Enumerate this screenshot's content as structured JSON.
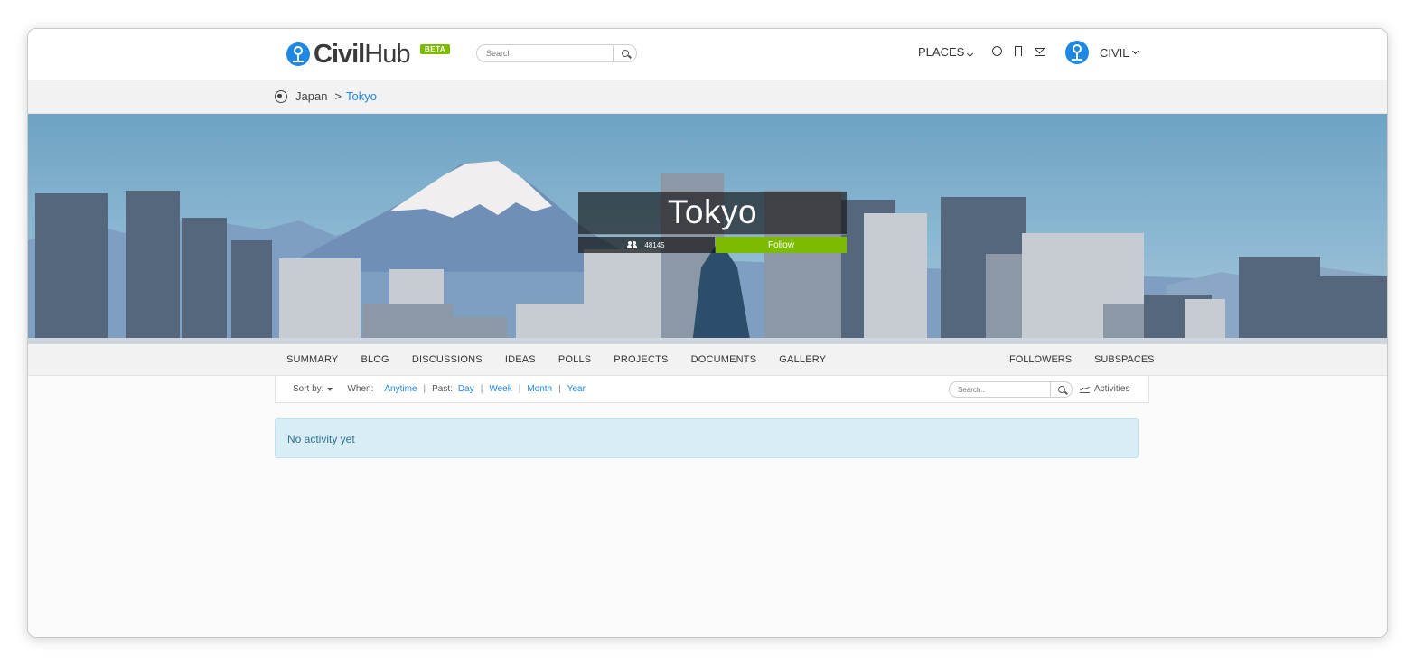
{
  "header": {
    "logo_main": "Civil",
    "logo_sub": "Hub",
    "beta_badge": "BETA",
    "search_placeholder": "Search",
    "places_label": "PLACES",
    "user_label": "CIVIL"
  },
  "breadcrumb": {
    "parent": "Japan",
    "separator": ">",
    "current": "Tokyo"
  },
  "banner": {
    "title": "Tokyo",
    "followers_count": "48145",
    "follow_label": "Follow"
  },
  "tabs": {
    "left": [
      "SUMMARY",
      "BLOG",
      "DISCUSSIONS",
      "IDEAS",
      "POLLS",
      "PROJECTS",
      "DOCUMENTS",
      "GALLERY"
    ],
    "right": [
      "FOLLOWERS",
      "SUBSPACES"
    ]
  },
  "filter": {
    "sort_label": "Sort by:",
    "when_label": "When:",
    "anytime": "Anytime",
    "past_label": "Past:",
    "day": "Day",
    "week": "Week",
    "month": "Month",
    "year": "Year",
    "search_placeholder": "Search..",
    "activities_label": "Activities"
  },
  "alert": {
    "message": "No activity yet"
  },
  "colors": {
    "brand_blue": "#1e88e5",
    "follow_green": "#7cbb00",
    "alert_bg": "#d9edf7",
    "alert_text": "#31708f"
  },
  "icons": [
    "logo-icon",
    "search-icon",
    "chevron-down-icon",
    "globe-icon",
    "bookmark-icon",
    "mail-icon",
    "avatar-icon",
    "earth-icon",
    "people-icon",
    "caret-down-icon",
    "activity-chart-icon"
  ]
}
